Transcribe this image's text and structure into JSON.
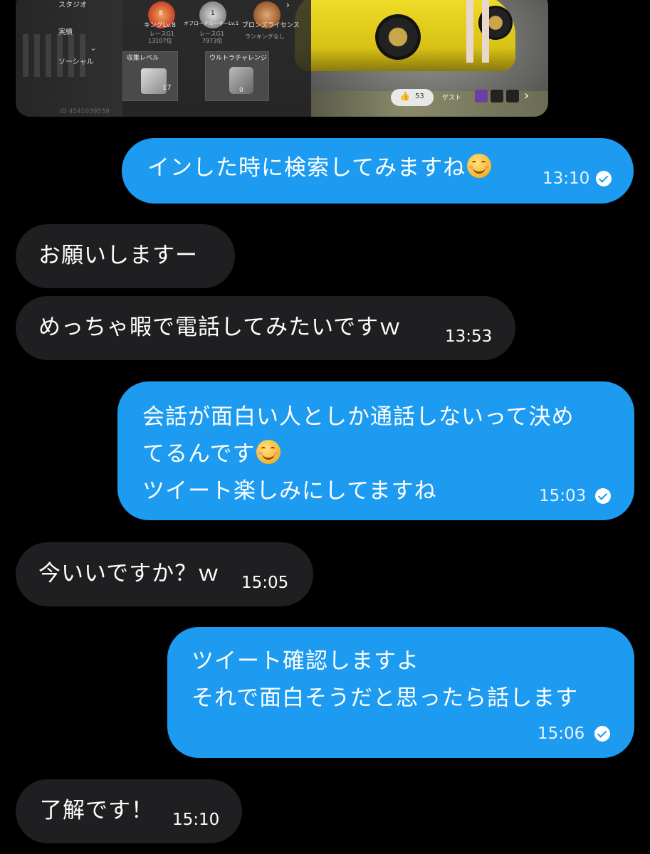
{
  "screenshot": {
    "menu": [
      "スタジオ",
      "実績",
      "ソーシャル"
    ],
    "badges": [
      {
        "level": "8",
        "title": "キングLv.8",
        "sub1": "レースG1",
        "sub2": "13107位"
      },
      {
        "level": "1",
        "title": "オフロードルーキーLv.1",
        "sub1": "レースG1",
        "sub2": "7973位"
      },
      {
        "level": "",
        "title": "ブロンズライセンス",
        "sub1": "ランキングなし",
        "sub2": ""
      }
    ],
    "tiles": [
      {
        "label": "収集レベル",
        "value": "17"
      },
      {
        "label": "ウルトラチャレンジ",
        "value": "0"
      }
    ],
    "likes": "53",
    "guest_label": "ゲスト",
    "player_id": "ID 4541039559"
  },
  "messages": [
    {
      "dir": "out",
      "lines": [
        "インした時に検索してみますね"
      ],
      "emoji_after_line": 0,
      "time": "13:10",
      "read": true
    },
    {
      "dir": "in",
      "lines": [
        "お願いしますー"
      ],
      "time": ""
    },
    {
      "dir": "in",
      "lines": [
        "めっちゃ暇で電話してみたいですｗ"
      ],
      "time": "13:53"
    },
    {
      "dir": "out",
      "lines": [
        "会話が面白い人としか通話しないって決め",
        "てるんです",
        "ツイート楽しみにしてますね"
      ],
      "emoji_after_line": 1,
      "time": "15:03",
      "read": true
    },
    {
      "dir": "in",
      "lines": [
        "今いいですか？ｗ"
      ],
      "time": "15:05"
    },
    {
      "dir": "out",
      "lines": [
        "ツイート確認しますよ",
        "それで面白そうだと思ったら話します"
      ],
      "time": "15:06",
      "read": true
    },
    {
      "dir": "in",
      "lines": [
        "了解です！"
      ],
      "time": "15:10"
    }
  ],
  "colors": {
    "outgoing": "#1d9bf0",
    "incoming": "#1f1f21",
    "background": "#000000"
  }
}
